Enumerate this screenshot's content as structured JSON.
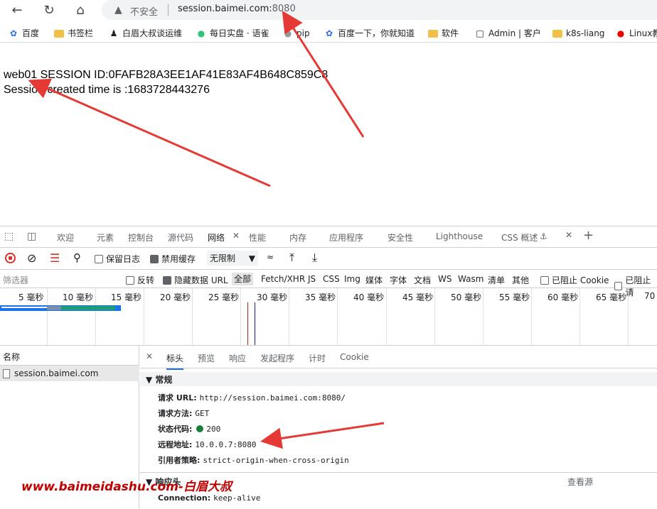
{
  "browser": {
    "back_icon": "arrow-left-icon",
    "reload_icon": "reload-icon",
    "home_icon": "home-icon",
    "security_label": "不安全",
    "url_host": "session.baimei.com:",
    "url_port": "8080"
  },
  "bookmarks": [
    {
      "icon": "paw-icon",
      "label": "百度"
    },
    {
      "icon": "folder-icon",
      "label": "书签栏"
    },
    {
      "icon": "person-icon",
      "label": "白眉大叔谈运维"
    },
    {
      "icon": "leaf-icon",
      "label": "每日实盘 · 语雀"
    },
    {
      "icon": "avatar-icon",
      "label": "pip"
    },
    {
      "icon": "paw-icon",
      "label": "百度一下，你就知道"
    },
    {
      "icon": "folder-icon",
      "label": "软件"
    },
    {
      "icon": "document-icon",
      "label": "Admin | 客户"
    },
    {
      "icon": "folder-icon",
      "label": "k8s-liang"
    },
    {
      "icon": "redhat-icon",
      "label": "Linux教"
    }
  ],
  "page": {
    "line1": "web01 SESSION ID:0FAFB28A3EE1AF41E83AF4B648C859C8",
    "line2": "Session created time is :1683728443276"
  },
  "devtools": {
    "tabs": [
      "欢迎",
      "元素",
      "控制台",
      "源代码",
      "网络",
      "性能",
      "内存",
      "应用程序",
      "安全性",
      "Lighthouse",
      "CSS 概述"
    ],
    "active_tab": "网络",
    "toolbar": {
      "preserve_log": "保留日志",
      "disable_cache": "禁用缓存",
      "throttle": "无限制"
    },
    "filter": {
      "placeholder": "筛选器",
      "invert": "反转",
      "hide_data_url": "隐藏数据 URL",
      "types": [
        "全部",
        "Fetch/XHR",
        "JS",
        "CSS",
        "Img",
        "媒体",
        "字体",
        "文档",
        "WS",
        "Wasm",
        "清单",
        "其他"
      ],
      "block_cookies": "已阻止 Cookie",
      "blocked_requests": "已阻止请"
    },
    "timeline_ticks": [
      "5 毫秒",
      "10 毫秒",
      "15 毫秒",
      "20 毫秒",
      "25 毫秒",
      "30 毫秒",
      "35 毫秒",
      "40 毫秒",
      "45 毫秒",
      "50 毫秒",
      "55 毫秒",
      "60 毫秒",
      "65 毫秒",
      "70"
    ],
    "requests_header": "名称",
    "request_name": "session.baimei.com",
    "detail_tabs": [
      "标头",
      "预览",
      "响应",
      "发起程序",
      "计时",
      "Cookie"
    ],
    "general_title": "常规",
    "general": {
      "url_key": "请求 URL:",
      "url_val": "http://session.baimei.com:8080/",
      "method_key": "请求方法:",
      "method_val": "GET",
      "status_key": "状态代码:",
      "status_val": "200",
      "remote_key": "远程地址:",
      "remote_val": "10.0.0.7:8080",
      "referrer_key": "引用者策略:",
      "referrer_val": "strict-origin-when-cross-origin"
    },
    "response_headers_title": "响应头",
    "view_source": "查看源",
    "connection_key": "Connection:",
    "connection_val": "keep-alive"
  },
  "watermark": "www.baimeidashu.com-白眉大叔",
  "colors": {
    "arrow": "#e53935",
    "watermark": "#c00000",
    "accent": "#1a73e8"
  }
}
